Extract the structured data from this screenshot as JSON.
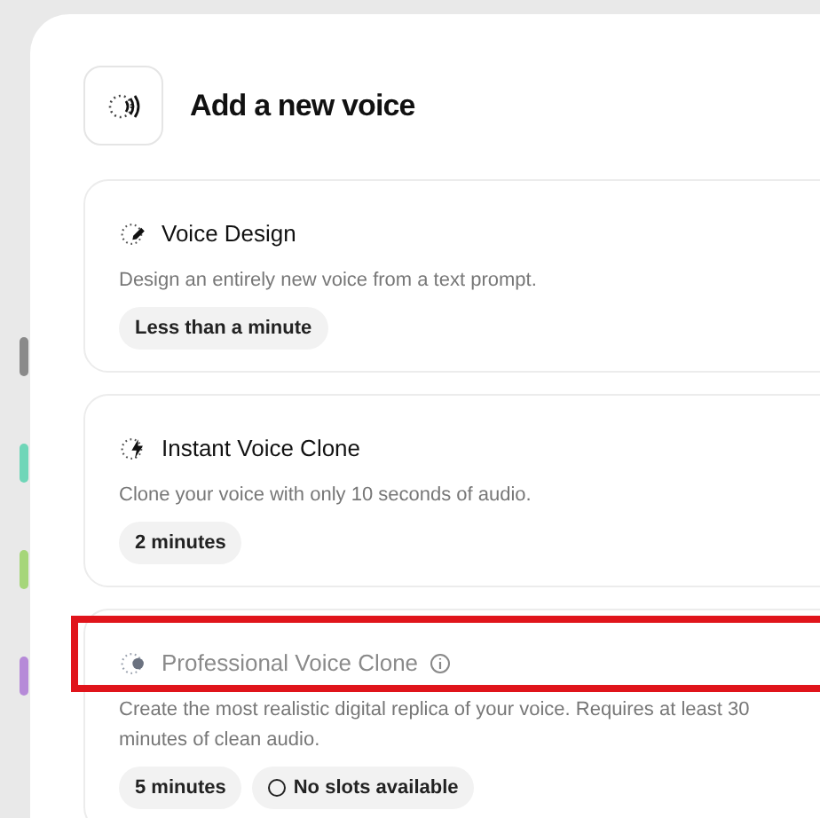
{
  "header": {
    "title": "Add a new voice"
  },
  "options": [
    {
      "title": "Voice Design",
      "kind": "pen",
      "disabled": false,
      "info": false,
      "description": "Design an entirely new voice from a text prompt.",
      "tags": [
        {
          "kind": "time",
          "label": "Less than a minute"
        }
      ]
    },
    {
      "title": "Instant Voice Clone",
      "kind": "bolt",
      "disabled": false,
      "info": false,
      "description": "Clone your voice with only 10 seconds of audio.",
      "tags": [
        {
          "kind": "time",
          "label": "2 minutes"
        }
      ]
    },
    {
      "title": "Professional Voice Clone",
      "kind": "dot",
      "disabled": true,
      "info": true,
      "highlighted": true,
      "description": "Create the most realistic digital replica of your voice. Requires at least 30 minutes of clean audio.",
      "tags": [
        {
          "kind": "time",
          "label": "5 minutes"
        },
        {
          "kind": "status",
          "label": "No slots available"
        }
      ]
    }
  ]
}
